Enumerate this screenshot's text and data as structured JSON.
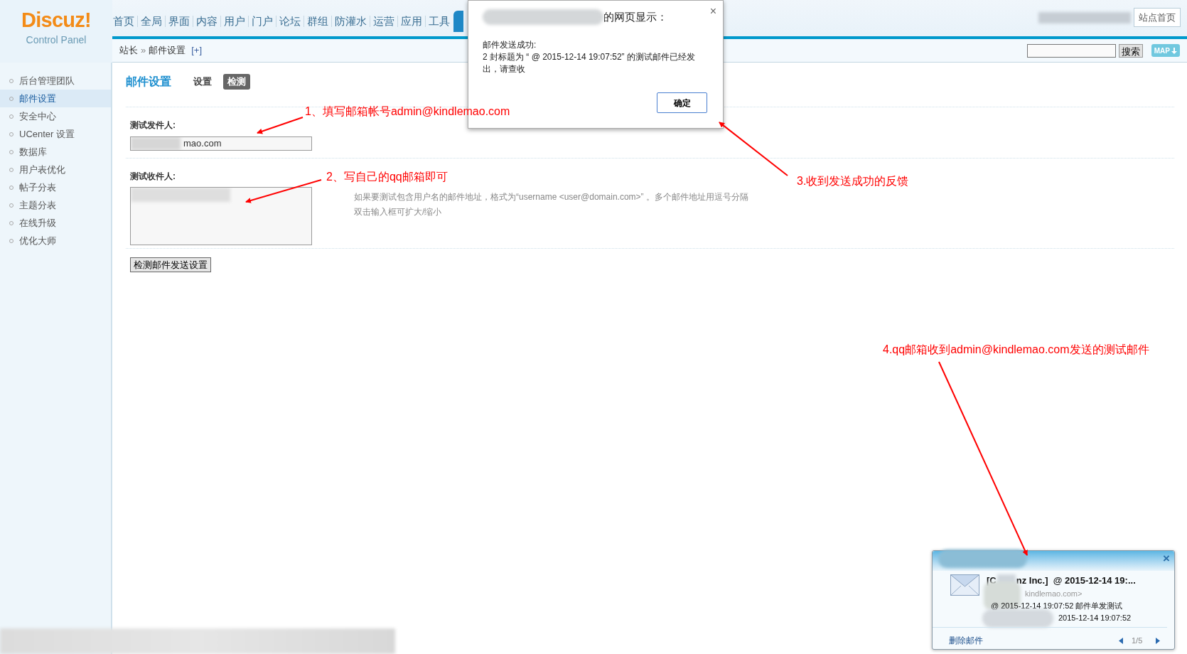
{
  "header": {
    "logo": "Discuz!",
    "logo_subtitle": "Control Panel",
    "nav": [
      "首页",
      "全局",
      "界面",
      "内容",
      "用户",
      "门户",
      "论坛",
      "群组",
      "防灌水",
      "运营",
      "应用",
      "工具"
    ],
    "site_home_button": "站点首页"
  },
  "breadcrumb": {
    "items": [
      "站长",
      "邮件设置"
    ],
    "separator": "»",
    "add": "[+]"
  },
  "search": {
    "button": "搜索",
    "map_button": "MAP"
  },
  "sidebar": {
    "items": [
      {
        "label": "后台管理团队",
        "selected": false
      },
      {
        "label": "邮件设置",
        "selected": true
      },
      {
        "label": "安全中心",
        "selected": false
      },
      {
        "label": "UCenter 设置",
        "selected": false
      },
      {
        "label": "数据库",
        "selected": false
      },
      {
        "label": "用户表优化",
        "selected": false
      },
      {
        "label": "帖子分表",
        "selected": false
      },
      {
        "label": "主题分表",
        "selected": false
      },
      {
        "label": "在线升级",
        "selected": false
      },
      {
        "label": "优化大师",
        "selected": false
      }
    ]
  },
  "page": {
    "title": "邮件设置",
    "tabs": [
      {
        "label": "设置",
        "selected": false
      },
      {
        "label": "检测",
        "selected": true
      }
    ],
    "fields": [
      {
        "kind": "input",
        "label": "测试发件人:",
        "value": "mao.com"
      },
      {
        "kind": "textarea",
        "label": "测试收件人:",
        "hints": [
          "如果要测试包含用户名的邮件地址，格式为“username <user@domain.com>” 。多个邮件地址用逗号分隔",
          "双击输入框可扩大/缩小"
        ]
      }
    ],
    "submit": "检测邮件发送设置"
  },
  "dialog": {
    "title": "的网页显示：",
    "close": "×",
    "message": [
      "邮件发送成功:",
      "2 封标题为 “ @ 2015-12-14 19:07:52” 的测试邮件已经发出，请查收"
    ],
    "button": "确定"
  },
  "notification": {
    "close": "×",
    "subject": "nz Inc.]  @ 2015-12-14 19:...",
    "subject_prefix": "[C",
    "sender": "kindlemao.com>",
    "body": "@ 2015-12-14 19:07:52 邮件单发测试",
    "time": "2015-12-14 19:07:52",
    "delete": "删除邮件",
    "page": "1/5"
  },
  "annotations": [
    "1、填写邮箱帐号admin@kindlemao.com",
    "2、写自己的qq邮箱即可",
    "3.收到发送成功的反馈",
    "4.qq邮箱收到admin@kindlemao.com发送的测试邮件"
  ]
}
